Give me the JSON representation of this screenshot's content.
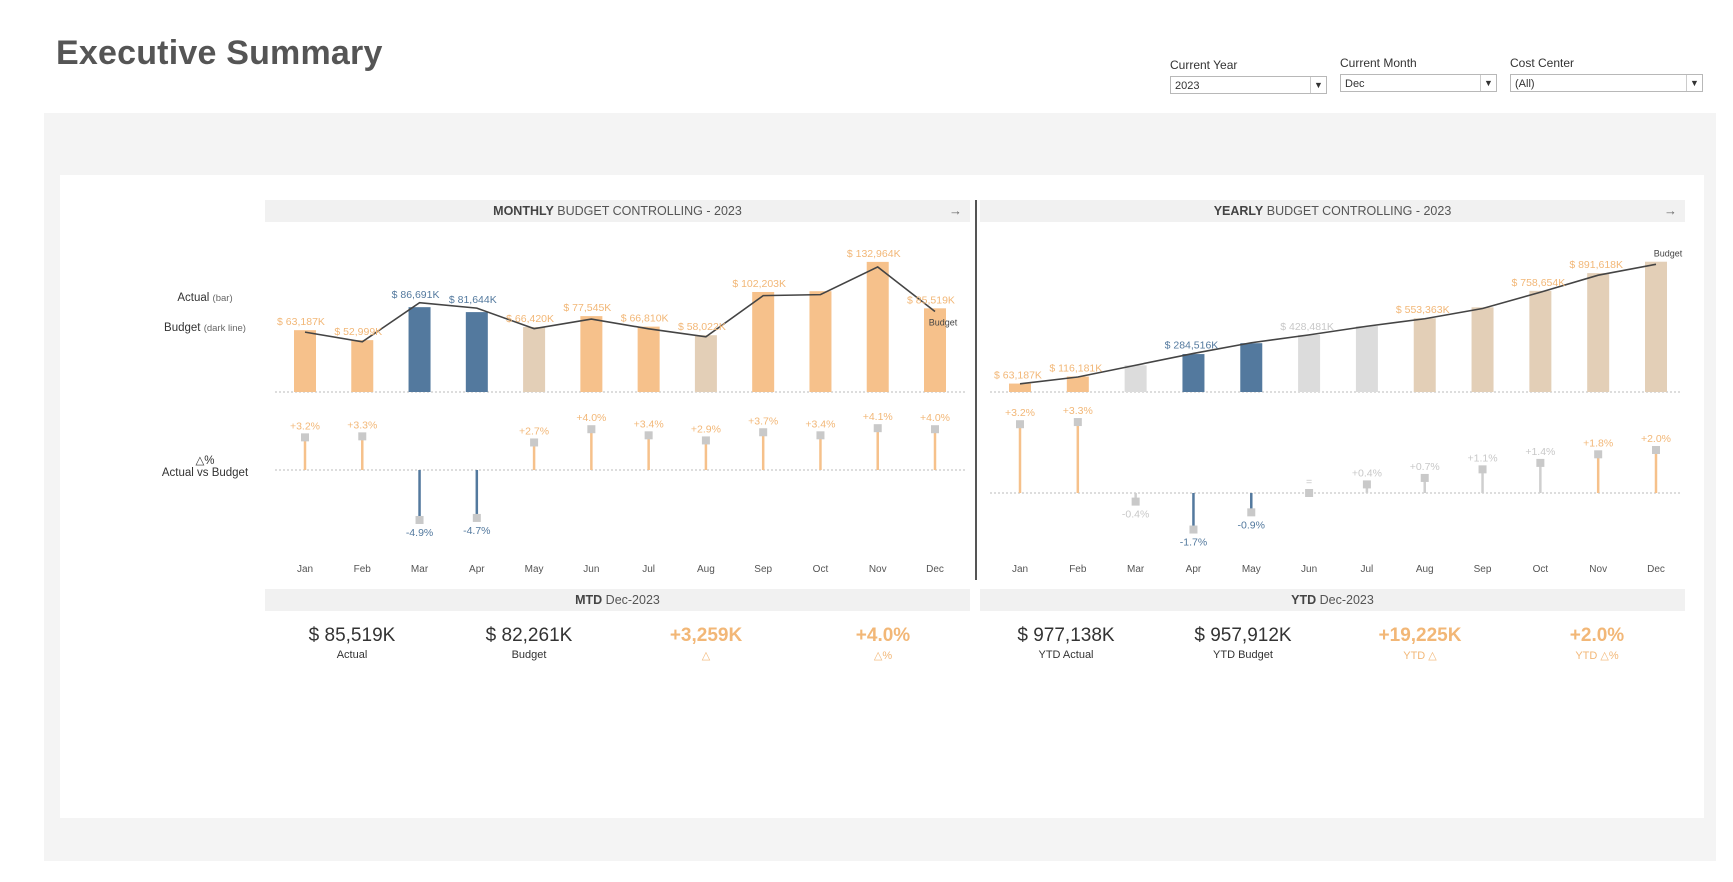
{
  "title": "Executive Summary",
  "filters": [
    {
      "label": "Current Year",
      "value": "2023"
    },
    {
      "label": "Current Month",
      "value": "Dec"
    },
    {
      "label": "Cost Center",
      "value": "(All)"
    }
  ],
  "side_labels": {
    "actual": "Actual",
    "actual_hint": "(bar)",
    "budget": "Budget",
    "budget_hint": "(dark line)",
    "delta_symbol": "△%",
    "delta_text": "Actual vs Budget"
  },
  "monthly_header": {
    "bold": "MONTHLY",
    "rest": " BUDGET CONTROLLING - 2023"
  },
  "yearly_header": {
    "bold": "YEARLY",
    "rest": " BUDGET CONTROLLING - 2023"
  },
  "mtd_header": {
    "bold": "MTD",
    "rest": " Dec-2023"
  },
  "ytd_header": {
    "bold": "YTD",
    "rest": " Dec-2023"
  },
  "arrow_icon": "→",
  "colors": {
    "orange": "#f6c18b",
    "beige": "#e3cfb7",
    "blue": "#53799e",
    "gray": "#dcdcdc",
    "line": "#444444",
    "orange_text": "#f2b777",
    "gray_text": "#c8c8c8"
  },
  "mtd_kpis": [
    {
      "value": "$ 85,519K",
      "label": "Actual",
      "hl": false
    },
    {
      "value": "$ 82,261K",
      "label": "Budget",
      "hl": false
    },
    {
      "value": "+3,259K",
      "label": "△",
      "hl": true
    },
    {
      "value": "+4.0%",
      "label": "△%",
      "hl": true
    }
  ],
  "ytd_kpis": [
    {
      "value": "$ 977,138K",
      "label": "YTD Actual",
      "hl": false
    },
    {
      "value": "$ 957,912K",
      "label": "YTD Budget",
      "hl": false
    },
    {
      "value": "+19,225K",
      "label": "YTD △",
      "hl": true
    },
    {
      "value": "+2.0%",
      "label": "YTD △%",
      "hl": true
    }
  ],
  "chart_data": [
    {
      "type": "bar",
      "title": "MONTHLY BUDGET CONTROLLING - 2023",
      "categories": [
        "Jan",
        "Feb",
        "Mar",
        "Apr",
        "May",
        "Jun",
        "Jul",
        "Aug",
        "Sep",
        "Oct",
        "Nov",
        "Dec"
      ],
      "series": [
        {
          "name": "Actual",
          "type": "bar",
          "values": [
            63187,
            52999,
            86691,
            81644,
            66420,
            77545,
            66810,
            58022,
            102203,
            103000,
            132964,
            85519
          ],
          "labels": [
            "$ 63,187K",
            "$ 52,999K",
            "$ 86,691K",
            "$ 81,644K",
            "$ 66,420K",
            "$ 77,545K",
            "$ 66,810K",
            "$ 58,022K",
            "$ 102,203K",
            "",
            "$ 132,964K",
            "$ 85,519K"
          ],
          "colors": [
            "orange",
            "orange",
            "blue",
            "blue",
            "beige",
            "orange",
            "orange",
            "beige",
            "orange",
            "orange",
            "orange",
            "orange"
          ]
        },
        {
          "name": "Budget",
          "type": "line",
          "values": [
            61200,
            51300,
            91200,
            85700,
            64700,
            74500,
            64600,
            56400,
            98500,
            99500,
            127800,
            82261
          ]
        }
      ],
      "delta": {
        "values": [
          3.2,
          3.3,
          -4.9,
          -4.7,
          2.7,
          4.0,
          3.4,
          2.9,
          3.7,
          3.4,
          4.1,
          4.0
        ],
        "labels": [
          "+3.2%",
          "+3.3%",
          "-4.9%",
          "-4.7%",
          "+2.7%",
          "+4.0%",
          "+3.4%",
          "+2.9%",
          "+3.7%",
          "+3.4%",
          "+4.1%",
          "+4.0%"
        ],
        "colors": [
          "orange",
          "orange",
          "blue",
          "blue",
          "orange",
          "orange",
          "orange",
          "orange",
          "orange",
          "orange",
          "orange",
          "orange"
        ]
      },
      "line_label": "Budget",
      "ylim": [
        0,
        140000
      ],
      "delta_ylim": [
        -6,
        5
      ]
    },
    {
      "type": "bar",
      "title": "YEARLY BUDGET CONTROLLING - 2023",
      "categories": [
        "Jan",
        "Feb",
        "Mar",
        "Apr",
        "May",
        "Jun",
        "Jul",
        "Aug",
        "Sep",
        "Oct",
        "Nov",
        "Dec"
      ],
      "series": [
        {
          "name": "Actual",
          "type": "bar",
          "values": [
            63187,
            116181,
            200000,
            284516,
            366000,
            428481,
            495000,
            553363,
            635000,
            758654,
            891618,
            977138
          ],
          "labels": [
            "$ 63,187K",
            "$ 116,181K",
            "",
            "$ 284,516K",
            "",
            "$ 428,481K",
            "",
            "$ 553,363K",
            "",
            "$ 758,654K",
            "$ 891,618K",
            ""
          ],
          "colors": [
            "orange",
            "orange",
            "gray",
            "blue",
            "blue",
            "gray",
            "gray",
            "beige",
            "beige",
            "beige",
            "beige",
            "beige"
          ]
        },
        {
          "name": "Budget",
          "type": "line",
          "values": [
            61200,
            112500,
            200800,
            289400,
            369300,
            428500,
            493000,
            549500,
            626200,
            748200,
            876000,
            957912
          ]
        }
      ],
      "delta": {
        "values": [
          3.2,
          3.3,
          -0.4,
          -1.7,
          -0.9,
          0.0,
          0.4,
          0.7,
          1.1,
          1.4,
          1.8,
          2.0
        ],
        "labels": [
          "+3.2%",
          "+3.3%",
          "-0.4%",
          "-1.7%",
          "-0.9%",
          "=",
          "+0.4%",
          "+0.7%",
          "+1.1%",
          "+1.4%",
          "+1.8%",
          "+2.0%"
        ],
        "colors": [
          "orange",
          "orange",
          "gray",
          "blue",
          "blue",
          "gray",
          "gray",
          "gray",
          "gray",
          "gray",
          "orange",
          "orange"
        ]
      },
      "line_label": "Budget",
      "ylim": [
        0,
        1050000
      ],
      "delta_ylim": [
        -2.5,
        4
      ]
    }
  ]
}
